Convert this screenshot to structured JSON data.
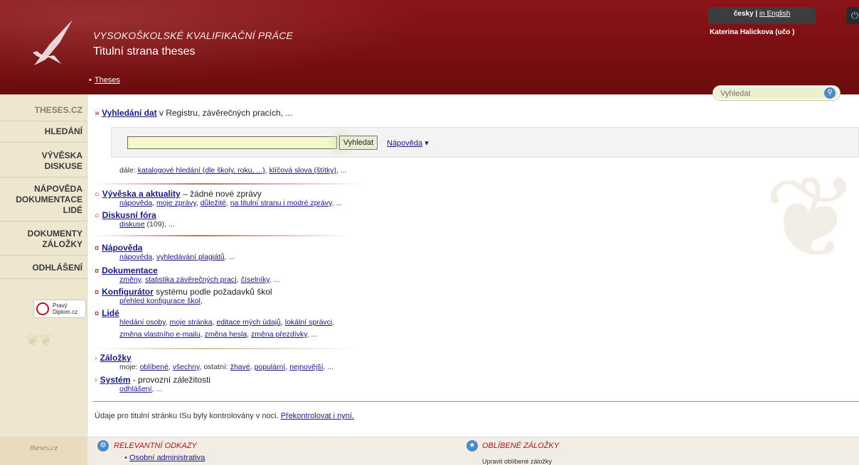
{
  "header": {
    "site_name": "VYSOKOŠKOLSKÉ KVALIFIKAČNÍ PRÁCE",
    "page_title": "Titulní strana theses",
    "breadcrumb": "Theses",
    "lang_current": "česky",
    "lang_sep": " | ",
    "lang_other": "in English",
    "user_name": "Katerina Halickova (učo ",
    "user_uco": "",
    "user_close": ")",
    "search_placeholder": "Vyhledat",
    "search_icon": "search-icon",
    "power_icon": "power-icon"
  },
  "sidebar": {
    "items": [
      {
        "label": "THESES.CZ"
      },
      {
        "label": "HLEDÁNÍ"
      },
      {
        "label": "VÝVĚSKA"
      },
      {
        "label": "DISKUSE"
      },
      {
        "label": "NÁPOVĚDA"
      },
      {
        "label": "DOKUMENTACE"
      },
      {
        "label": "LIDÉ"
      },
      {
        "label": "DOKUMENTY"
      },
      {
        "label": "ZÁLOŽKY"
      },
      {
        "label": "ODHLÁŠENÍ"
      }
    ],
    "diplom_line1": "Pravý",
    "diplom_line2": "Diplom.cz"
  },
  "main": {
    "search_title": "Vyhledání dat",
    "search_title_rest": " v Registru, závěrečných pracích, ...",
    "search_button": "Vyhledat",
    "help_link": "Nápověda",
    "dale_prefix": "dále: ",
    "dale_link1": "katalogové hledání (dle školy, roku, ...)",
    "dale_link2": "klíčová slova (štítky)",
    "dale_suffix": ", ...",
    "vyveska_title": "Vývěska a aktuality",
    "vyveska_rest": " – žádné nové zprávy",
    "vyveska_links": [
      "nápověda",
      "moje zprávy",
      "důležité",
      "na titulní stranu i modré zprávy"
    ],
    "diskuse_title": "Diskusní fóra",
    "diskuse_link": "diskuse",
    "diskuse_count": " (109), ...",
    "napoveda_title": "Nápověda",
    "napoveda_links": [
      "nápověda",
      "vyhledávání plagiátů"
    ],
    "dokumentace_title": "Dokumentace",
    "dokumentace_links": [
      "změny",
      "statistika závěrečných prací",
      "číselníky"
    ],
    "konfigurator_title": "Konfigurátor",
    "konfigurator_rest": " systému podle požadavků škol",
    "konfigurator_link": "přehled konfigurace škol",
    "lide_title": "Lidé",
    "lide_links1": [
      "hledání osoby",
      "moje stránka",
      "editace mých údajů",
      "lokální správci"
    ],
    "lide_links2": [
      "změna vlastního e-mailu",
      "změna hesla",
      "změna přezdívky"
    ],
    "zalozky_title": "Záložky",
    "zalozky_moje": "moje: ",
    "zalozky_moje_links": [
      "oblíbené",
      "všechny"
    ],
    "zalozky_ostatni": ", ostatní: ",
    "zalozky_ost_links": [
      "žhavé",
      "populární",
      "nejnovější"
    ],
    "system_title": "Systém",
    "system_rest": " - provozní záležitosti",
    "system_link": "odhlášení",
    "ellipsis": ", ...",
    "comma": ", ",
    "check_text": "Údaje pro titulní stránku ISu byly kontrolovány v noci. ",
    "check_link": "Překontrolovat i nyní."
  },
  "footer": {
    "brand": "theses.cz",
    "relevant_title": "RELEVANTNÍ ODKAZY",
    "relevant_link": "Osobní administrativa",
    "fav_title": "OBLÍBENÉ ZÁLOŽKY",
    "fav_link": "Upravit oblíbené záložky"
  },
  "colors": {
    "header": "#7a0f12",
    "sidebar": "#efe6cf",
    "accent": "#b0121a",
    "link": "#1a1a80"
  }
}
